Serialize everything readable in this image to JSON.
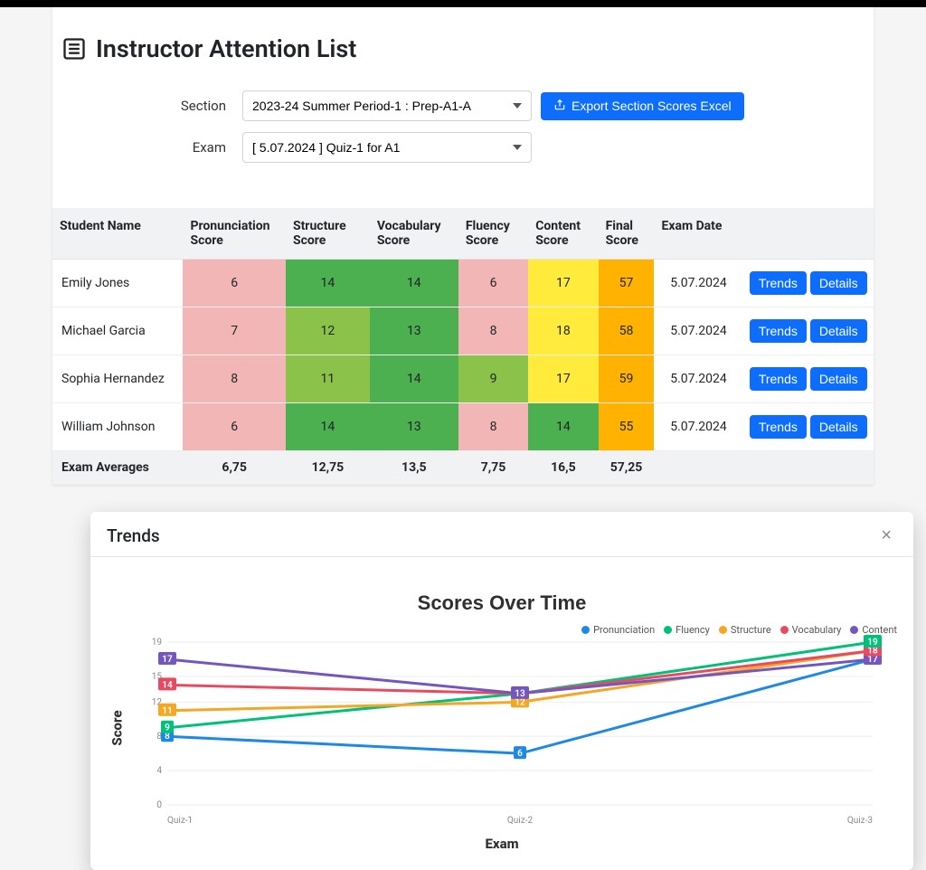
{
  "header": {
    "title": "Instructor Attention List"
  },
  "form": {
    "section_label": "Section",
    "section_value": "2023-24 Summer Period-1 : Prep-A1-A",
    "exam_label": "Exam",
    "exam_value": "[ 5.07.2024 ] Quiz-1 for A1",
    "export_label": "Export Section Scores Excel"
  },
  "table": {
    "columns": {
      "student": "Student Name",
      "pron": "Pronunciation Score",
      "struct": "Structure Score",
      "vocab": "Vocabulary Score",
      "fluency": "Fluency Score",
      "content": "Content Score",
      "final": "Final Score",
      "date": "Exam Date"
    },
    "rows": [
      {
        "name": "Emily Jones",
        "pron": "6",
        "struct": "14",
        "vocab": "14",
        "fluency": "6",
        "content": "17",
        "final": "57",
        "date": "5.07.2024",
        "colors": {
          "pron": "#f2b6b6",
          "struct": "#4caf50",
          "vocab": "#4caf50",
          "fluency": "#f2b6b6",
          "content": "#ffeb3b",
          "final": "#ffb300"
        }
      },
      {
        "name": "Michael Garcia",
        "pron": "7",
        "struct": "12",
        "vocab": "13",
        "fluency": "8",
        "content": "18",
        "final": "58",
        "date": "5.07.2024",
        "colors": {
          "pron": "#f2b6b6",
          "struct": "#8bc34a",
          "vocab": "#4caf50",
          "fluency": "#f2b6b6",
          "content": "#ffeb3b",
          "final": "#ffb300"
        }
      },
      {
        "name": "Sophia Hernandez",
        "pron": "8",
        "struct": "11",
        "vocab": "14",
        "fluency": "9",
        "content": "17",
        "final": "59",
        "date": "5.07.2024",
        "colors": {
          "pron": "#f2b6b6",
          "struct": "#8bc34a",
          "vocab": "#4caf50",
          "fluency": "#8bc34a",
          "content": "#ffeb3b",
          "final": "#ffb300"
        }
      },
      {
        "name": "William Johnson",
        "pron": "6",
        "struct": "14",
        "vocab": "13",
        "fluency": "8",
        "content": "14",
        "final": "55",
        "date": "5.07.2024",
        "colors": {
          "pron": "#f2b6b6",
          "struct": "#4caf50",
          "vocab": "#4caf50",
          "fluency": "#f2b6b6",
          "content": "#4caf50",
          "final": "#ffb300"
        }
      }
    ],
    "actions": {
      "trends": "Trends",
      "details": "Details"
    },
    "averages": {
      "label": "Exam Averages",
      "pron": "6,75",
      "struct": "12,75",
      "vocab": "13,5",
      "fluency": "7,75",
      "content": "16,5",
      "final": "57,25"
    }
  },
  "modal": {
    "title": "Trends"
  },
  "chart_data": {
    "type": "line",
    "title": "Scores Over Time",
    "xlabel": "Exam",
    "ylabel": "Score",
    "categories": [
      "Quiz-1",
      "Quiz-2",
      "Quiz-3"
    ],
    "ylim": [
      0,
      19
    ],
    "y_ticks": [
      0,
      4,
      8,
      12,
      15,
      19
    ],
    "series": [
      {
        "name": "Pronunciation",
        "color": "#1e88e5",
        "values": [
          8,
          6,
          17
        ]
      },
      {
        "name": "Fluency",
        "color": "#00c07a",
        "values": [
          9,
          13,
          19
        ]
      },
      {
        "name": "Structure",
        "color": "#f5a623",
        "values": [
          11,
          12,
          18
        ]
      },
      {
        "name": "Vocabulary",
        "color": "#e84a5f",
        "values": [
          14,
          13,
          18
        ]
      },
      {
        "name": "Content",
        "color": "#7356bf",
        "values": [
          17,
          13,
          17
        ]
      }
    ],
    "point_labels": {
      "Quiz-1": [
        8,
        9,
        11,
        14,
        17
      ],
      "Quiz-2": [
        6,
        12,
        13
      ],
      "Quiz-3": [
        17,
        18,
        19
      ]
    }
  }
}
